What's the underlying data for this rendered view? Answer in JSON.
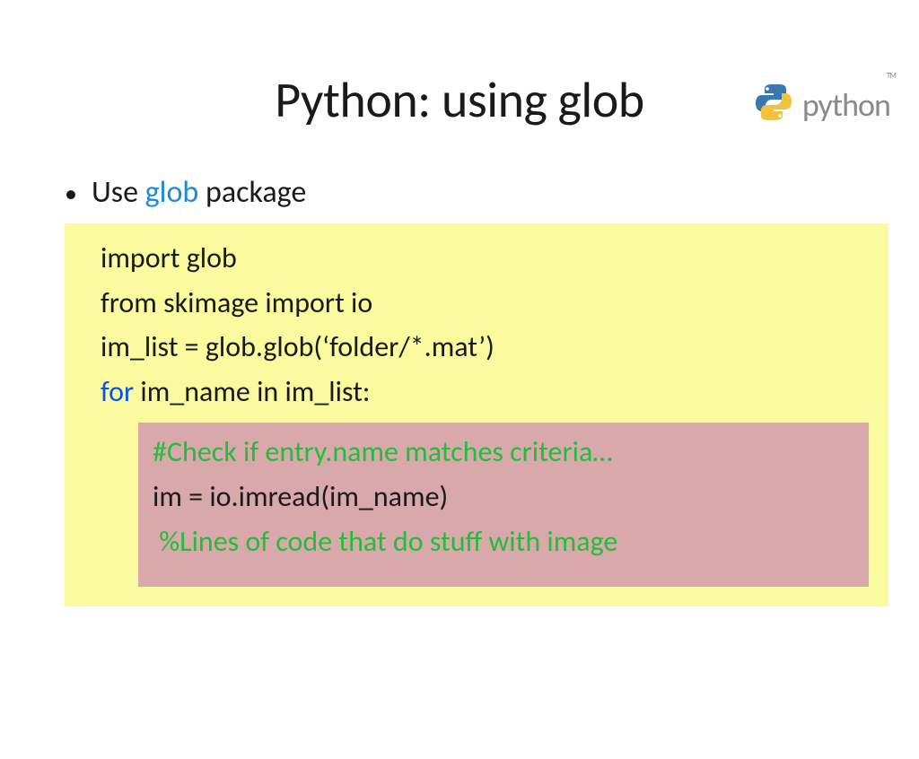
{
  "logo": {
    "name": "python",
    "tm": "TM",
    "colors": {
      "blue": "#3a78b1",
      "yellow": "#f2c23f"
    }
  },
  "title": "Python: using glob",
  "bullet": {
    "prefix": "Use ",
    "keyword": "glob",
    "suffix": " package"
  },
  "code": {
    "line1": "import glob",
    "line2": "from skimage import io",
    "line3": "im_list = glob.glob(‘folder/*.mat’)",
    "line4_for": "for",
    "line4_rest": " im_name in im_list:",
    "inner1": "#Check if entry.name matches criteria…",
    "inner2": "im = io.imread(im_name)",
    "inner3": " %Lines of code that do stuff with image"
  }
}
